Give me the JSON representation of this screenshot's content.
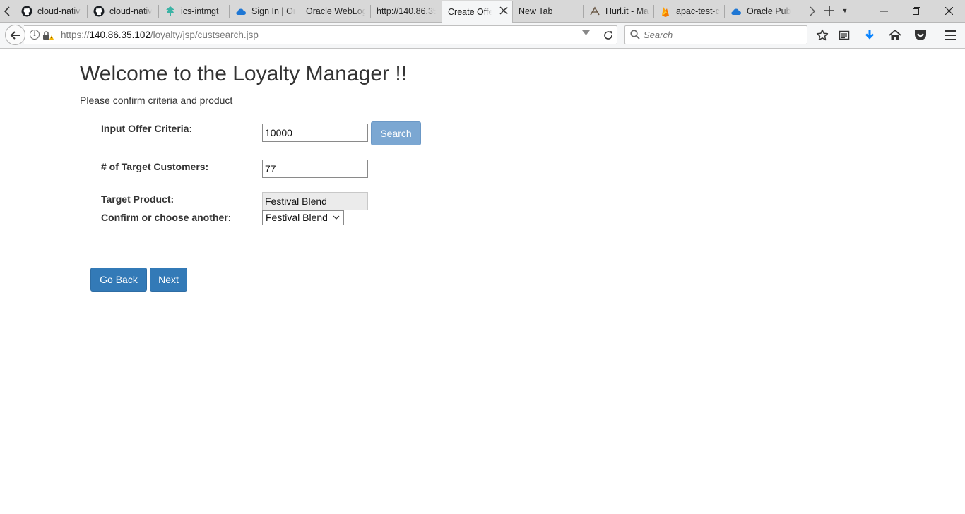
{
  "browser": {
    "tabs": [
      {
        "label": "cloud-nativ",
        "icon": "github-icon"
      },
      {
        "label": "cloud-nativ",
        "icon": "github-icon"
      },
      {
        "label": "ics-intmgt",
        "icon": "tree-icon"
      },
      {
        "label": "Sign In | Or",
        "icon": "cloud-icon"
      },
      {
        "label": "Oracle WebLog",
        "icon": ""
      },
      {
        "label": "http://140.86.35",
        "icon": ""
      },
      {
        "label": "Create Offe",
        "icon": "",
        "active": true
      },
      {
        "label": "New Tab",
        "icon": ""
      },
      {
        "label": "Hurl.it - Ma",
        "icon": "hurl-icon"
      },
      {
        "label": "apac-test-c",
        "icon": "firebase-icon"
      },
      {
        "label": "Oracle Pub",
        "icon": "cloud-icon"
      }
    ],
    "url": {
      "prefix": "https://",
      "host": "140.86.35.102",
      "path": "/loyalty/jsp/custsearch.jsp"
    },
    "search_placeholder": "Search"
  },
  "page": {
    "title": "Welcome to the Loyalty Manager !!",
    "subtitle": "Please confirm criteria and product",
    "offer_criteria_label": "Input Offer Criteria:",
    "offer_criteria_value": "10000",
    "search_button": "Search",
    "target_customers_label": "# of Target Customers:",
    "target_customers_value": "77",
    "target_product_label": "Target Product:",
    "target_product_value": "Festival Blend",
    "confirm_label": "Confirm or choose another:",
    "product_select_value": "Festival Blend",
    "go_back_button": "Go Back",
    "next_button": "Next"
  },
  "colors": {
    "primary": "#337ab7",
    "search_button": "#7ba7d2",
    "download_arrow": "#0a84ff"
  }
}
